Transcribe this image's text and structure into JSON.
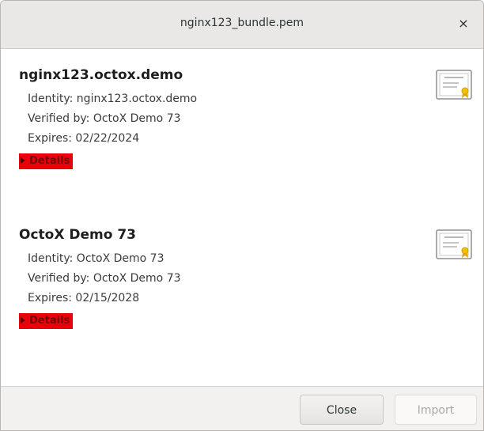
{
  "window": {
    "title": "nginx123_bundle.pem",
    "close_glyph": "×"
  },
  "certificates": [
    {
      "name": "nginx123.octox.demo",
      "identity": "Identity: nginx123.octox.demo",
      "verified_by": "Verified by: OctoX Demo 73",
      "expires": "Expires: 02/22/2024",
      "details_label": "Details",
      "icon": "certificate-icon"
    },
    {
      "name": "OctoX Demo 73",
      "identity": "Identity: OctoX Demo 73",
      "verified_by": "Verified by: OctoX Demo 73",
      "expires": "Expires: 02/15/2028",
      "details_label": "Details",
      "icon": "certificate-icon"
    }
  ],
  "footer": {
    "close_label": "Close",
    "import_label": "Import",
    "import_enabled": false
  },
  "colors": {
    "details_highlight": "#e8000b",
    "titlebar": "#e9e8e6",
    "footer": "#f2f1f0"
  }
}
